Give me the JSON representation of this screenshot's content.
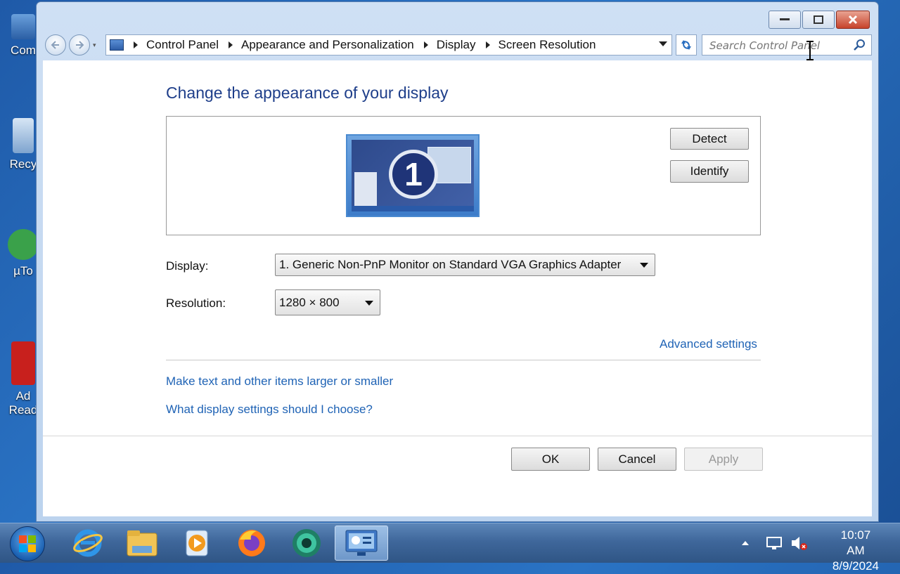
{
  "desktop": {
    "icons": [
      "Com",
      "Recy",
      "µTo",
      "Ad",
      "Read"
    ]
  },
  "window": {
    "address": {
      "crumbs": [
        "Control Panel",
        "Appearance and Personalization",
        "Display",
        "Screen Resolution"
      ]
    },
    "search": {
      "placeholder": "Search Control Panel"
    },
    "heading": "Change the appearance of your display",
    "monitor_number": "1",
    "detect_label": "Detect",
    "identify_label": "Identify",
    "display_label": "Display:",
    "display_value": "1. Generic Non-PnP Monitor on Standard VGA Graphics Adapter",
    "resolution_label": "Resolution:",
    "resolution_value": "1280 × 800",
    "advanced_link": "Advanced settings",
    "links": [
      "Make text and other items larger or smaller",
      "What display settings should I choose?"
    ],
    "ok_label": "OK",
    "cancel_label": "Cancel",
    "apply_label": "Apply"
  },
  "taskbar": {
    "apps": [
      "internet-explorer-icon",
      "file-explorer-icon",
      "media-player-icon",
      "firefox-icon",
      "browser-app-icon",
      "control-panel-display-icon"
    ],
    "time": "10:07 AM",
    "date": "8/9/2024"
  },
  "colors": {
    "heading": "#1e3e8a",
    "link": "#1f63b5",
    "close_button": "#c7432c"
  }
}
